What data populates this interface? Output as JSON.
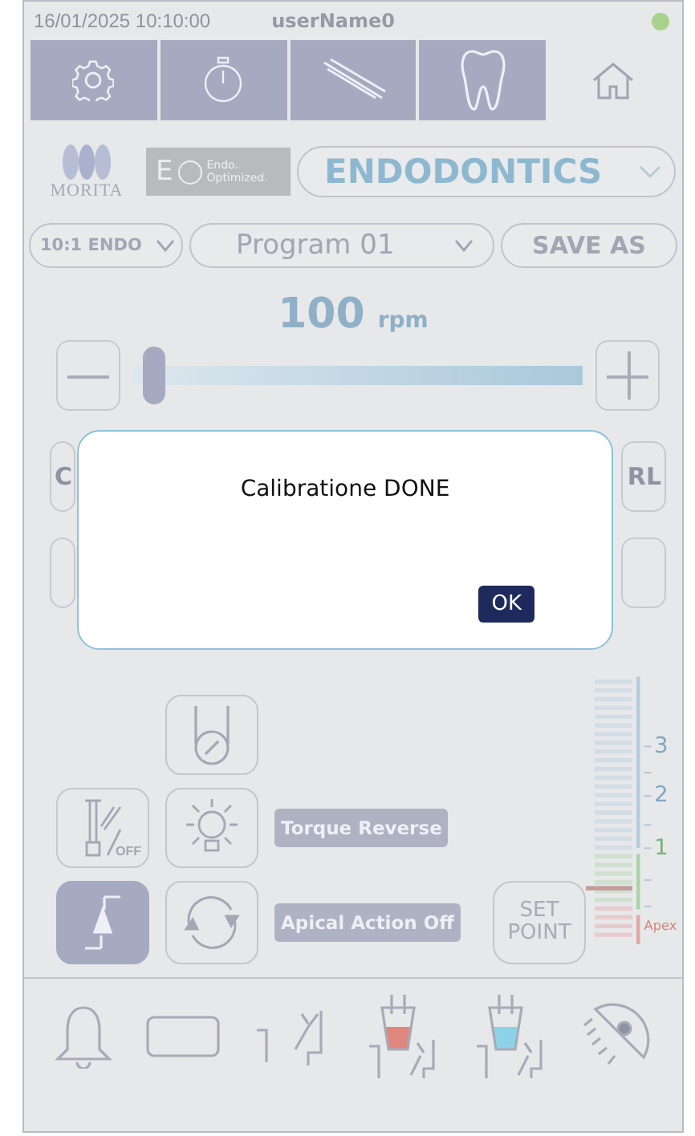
{
  "status_bar": {
    "datetime": "16/01/2025 10:10:00",
    "user": "userName0",
    "connected": true
  },
  "nav_tabs": [
    {
      "kind": "settings",
      "selected": false
    },
    {
      "kind": "timer",
      "selected": false
    },
    {
      "kind": "handpiece",
      "selected": false
    },
    {
      "kind": "tooth",
      "selected": false
    },
    {
      "kind": "home",
      "selected": true
    }
  ],
  "brand": {
    "logo_text": "MORITA",
    "badge_letter": "E",
    "badge_text": "Endo. Optimized."
  },
  "mode_select": {
    "value": "ENDODONTICS"
  },
  "handpiece_select": {
    "value": "10:1 ENDO"
  },
  "program_select": {
    "value": "Program 01"
  },
  "save_as_button": "SAVE AS",
  "speed": {
    "value": "100",
    "unit": "rpm",
    "level": 0.0
  },
  "background_row": {
    "left_label": "C",
    "right_label": "RL"
  },
  "dialog": {
    "message": "Calibratione DONE",
    "ok_button": "OK"
  },
  "toggles": [
    {
      "kind": "holder",
      "selected": false
    },
    {
      "kind": "spray_off",
      "label": "OFF",
      "selected": false
    },
    {
      "kind": "light",
      "selected": false
    },
    {
      "kind": "pedal",
      "selected": true
    },
    {
      "kind": "rotation",
      "selected": false
    }
  ],
  "mode_labels": [
    "Torque Reverse",
    "Apical Action Off"
  ],
  "set_point_button": "SET POINT",
  "apex_meter": {
    "scale_labels": [
      "3",
      "2",
      "1",
      "Apex"
    ]
  },
  "bottom_icons": [
    {
      "kind": "bell"
    },
    {
      "kind": "rectangle"
    },
    {
      "kind": "spittoon"
    },
    {
      "kind": "cup",
      "color": "#e0877d"
    },
    {
      "kind": "cup",
      "color": "#8ed2ea"
    },
    {
      "kind": "lamp"
    }
  ]
}
